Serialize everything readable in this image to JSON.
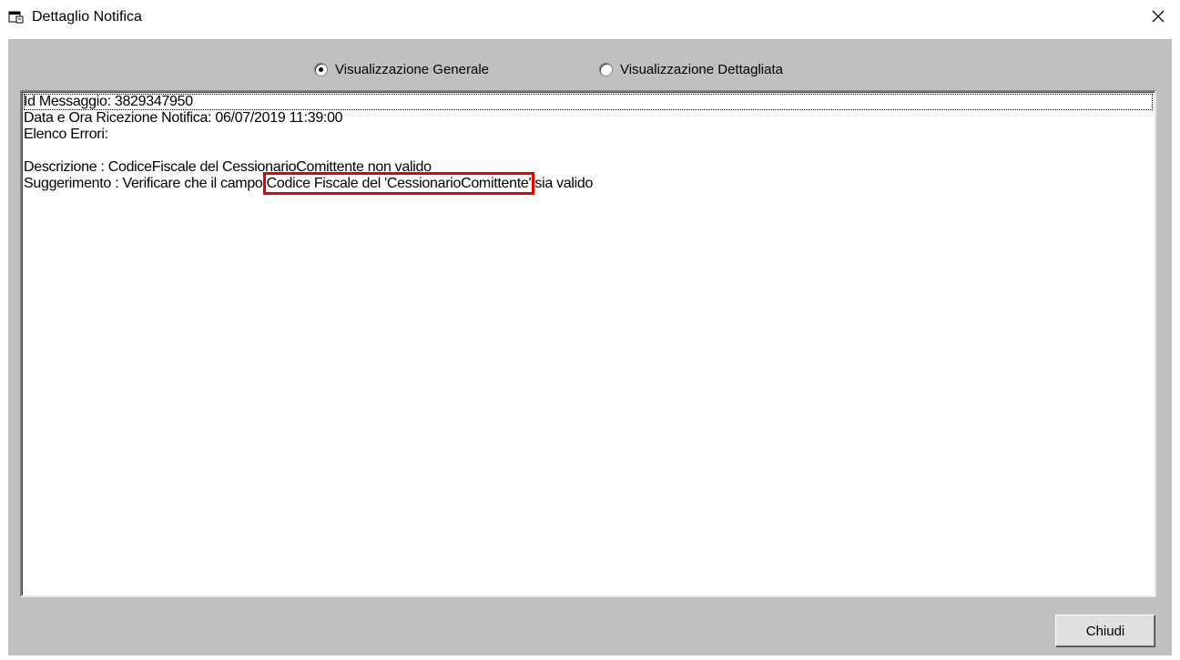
{
  "window": {
    "title": "Dettaglio Notifica",
    "icon": "window-icon",
    "close_icon": "close-icon"
  },
  "view_mode": {
    "options": [
      {
        "label": "Visualizzazione Generale",
        "checked": true
      },
      {
        "label": "Visualizzazione Dettagliata",
        "checked": false
      }
    ]
  },
  "details": {
    "line1": "Id Messaggio: 3829347950",
    "line2": "Data e Ora Ricezione Notifica: 06/07/2019 11:39:00",
    "line3": "Elenco Errori:",
    "line4": "",
    "line5": "Descrizione : CodiceFiscale del CessionarioComittente non valido",
    "line6_prefix": "Suggerimento : Verificare che il campo ",
    "line6_highlight": "Codice Fiscale del 'CessionarioComittente'",
    "line6_suffix": " sia valido",
    "highlight_color": "#e80000"
  },
  "buttons": {
    "close_label": "Chiudi"
  }
}
